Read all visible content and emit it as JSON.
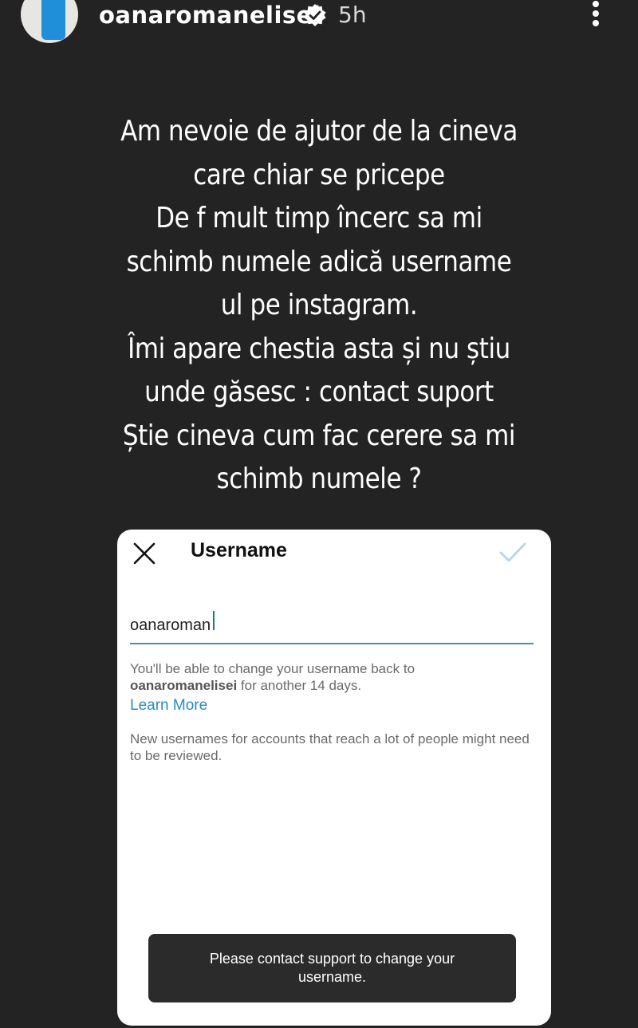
{
  "header": {
    "username": "oanaromanelisei",
    "time_ago": "5h"
  },
  "story": {
    "lines": [
      "Am nevoie de ajutor de la cineva",
      "care chiar se pricepe",
      "De f mult timp încerc sa mi",
      "schimb numele adică username",
      "ul pe instagram.",
      "Îmi apare chestia asta și nu  știu",
      "unde găsesc : contact suport",
      "Știe cineva cum fac cerere sa mi",
      "schimb numele ?"
    ]
  },
  "card": {
    "title": "Username",
    "input_value": "oanaroman",
    "helper_prefix": "You'll be able to change your username back to",
    "helper_username": "oanaromanelisei",
    "helper_suffix": "for another 14 days.",
    "learn_more": "Learn More",
    "review_note": "New usernames for accounts that reach a lot of people might need to be reviewed.",
    "toast": "Please contact support to change your username."
  },
  "colors": {
    "background": "#232323",
    "accent_blue": "#2a8bc4",
    "check_disabled": "#b8d4ec"
  },
  "icons": [
    "verified-badge-icon",
    "more-vertical-icon",
    "close-icon",
    "check-icon"
  ]
}
